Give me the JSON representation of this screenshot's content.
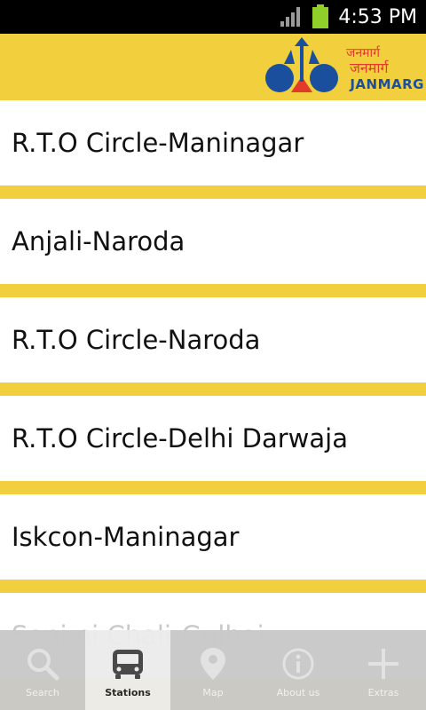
{
  "status_bar": {
    "time": "4:53 PM",
    "icons": [
      "signal-icon",
      "battery-icon"
    ],
    "battery_color": "#8fd12a"
  },
  "header": {
    "logo_hindi": "जनमार्ग",
    "logo_hindi_2": "जनमार्ग",
    "logo_brand": "JANMARG",
    "accent": "#f2cf3c"
  },
  "routes": [
    {
      "label": "R.T.O Circle-Maninagar"
    },
    {
      "label": "Anjali-Naroda"
    },
    {
      "label": "R.T.O Circle-Naroda"
    },
    {
      "label": "R.T.O Circle-Delhi Darwaja"
    },
    {
      "label": "Iskcon-Maninagar"
    },
    {
      "label": "Soni ni Chali-Gulbai"
    }
  ],
  "tabs": [
    {
      "label": "Search",
      "icon": "search-icon",
      "active": false
    },
    {
      "label": "Stations",
      "icon": "bus-icon",
      "active": true
    },
    {
      "label": "Map",
      "icon": "map-pin-icon",
      "active": false
    },
    {
      "label": "About us",
      "icon": "info-icon",
      "active": false
    },
    {
      "label": "Extras",
      "icon": "plus-icon",
      "active": false
    }
  ]
}
